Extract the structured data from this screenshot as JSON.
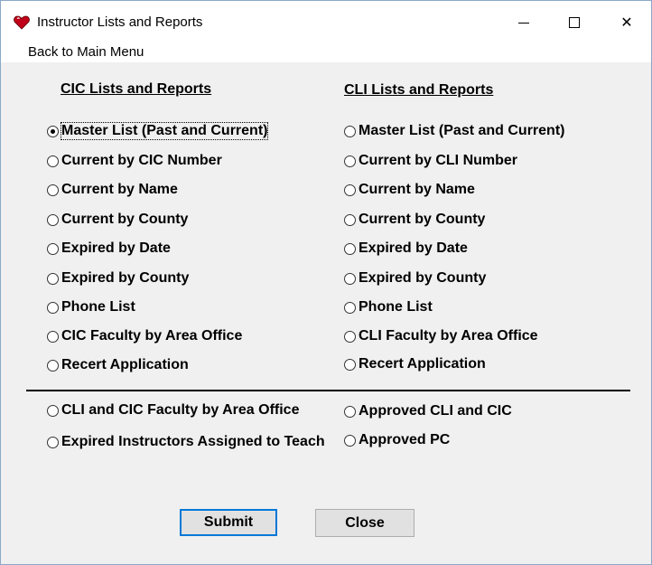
{
  "window": {
    "title": "Instructor Lists and Reports",
    "minimize_glyph": "",
    "close_glyph": "✕"
  },
  "menu": {
    "back_label": "Back to Main Menu"
  },
  "cic": {
    "heading": "CIC Lists and Reports",
    "options": [
      "Master List (Past and Current)",
      "Current by CIC Number",
      "Current by Name",
      "Current by County",
      "Expired by Date",
      "Expired by County",
      "Phone List",
      "CIC Faculty by Area Office",
      "Recert Application"
    ],
    "selected_index": 0
  },
  "cli": {
    "heading": "CLI Lists and Reports",
    "options": [
      "Master List (Past and Current)",
      "Current by CLI Number",
      "Current by Name",
      "Current by County",
      "Expired by Date",
      "Expired by County",
      "Phone List",
      "CLI Faculty by Area Office",
      "Recert Application"
    ]
  },
  "other": {
    "left": [
      "CLI and CIC Faculty by Area Office",
      "Expired Instructors Assigned to Teach"
    ],
    "right": [
      "Approved CLI and CIC",
      "Approved PC"
    ]
  },
  "buttons": {
    "submit": "Submit",
    "close": "Close"
  },
  "colors": {
    "accent": "#0078d7",
    "window_bg": "#f0f0f0",
    "app_icon": "#c0001a"
  },
  "icons": {
    "app": "heart-icon",
    "minimize": "minimize-icon",
    "maximize": "maximize-icon",
    "close": "close-icon"
  }
}
